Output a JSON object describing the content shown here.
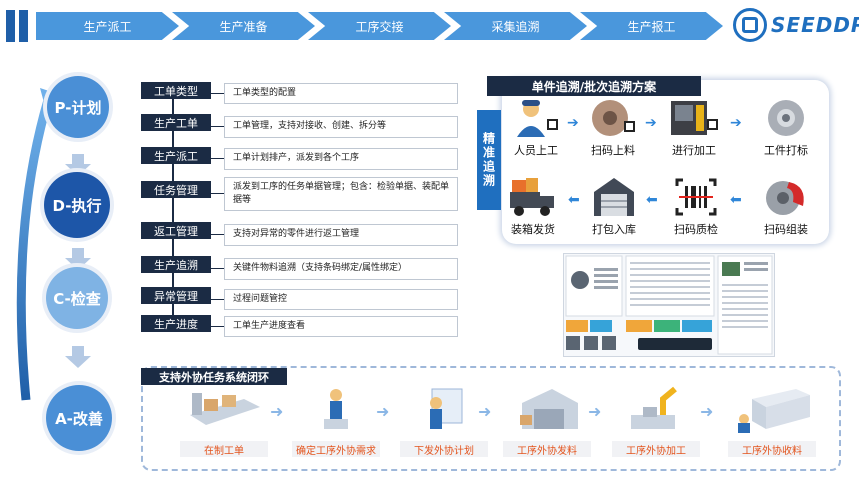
{
  "nav": {
    "steps": [
      "生产派工",
      "生产准备",
      "工序交接",
      "采集追溯",
      "生产报工"
    ]
  },
  "brand": {
    "logo_text": "SEEDDP",
    "color": "#1f6fbf"
  },
  "pdca": [
    {
      "label": "P-计划"
    },
    {
      "label": "D-执行"
    },
    {
      "label": "C-检查"
    },
    {
      "label": "A-改善"
    }
  ],
  "functions": [
    {
      "label": "工单类型",
      "desc": "工单类型的配置"
    },
    {
      "label": "生产工单",
      "desc": "工单管理，支持对接收、创建、拆分等"
    },
    {
      "label": "生产派工",
      "desc": "工单计划排产，派发到各个工序"
    },
    {
      "label": "任务管理",
      "desc": "派发到工序的任务单据管理；包含：检验单据、装配单据等"
    },
    {
      "label": "返工管理",
      "desc": "支持对异常的零件进行返工管理"
    },
    {
      "label": "生产追溯",
      "desc": "关键件物料追溯（支持条码绑定/属性绑定）"
    },
    {
      "label": "异常管理",
      "desc": "过程问题管控"
    },
    {
      "label": "生产进度",
      "desc": "工单生产进度查看"
    }
  ],
  "trace": {
    "title": "单件追溯/批次追溯方案",
    "side_label": "精准追溯",
    "steps": [
      "人员上工",
      "扫码上料",
      "进行加工",
      "工件打标",
      "装箱发货",
      "打包入库",
      "扫码质检",
      "扫码组装"
    ]
  },
  "outsource": {
    "title": "支持外协任务系统闭环",
    "steps": [
      "在制工单",
      "确定工序外协需求",
      "下发外协计划",
      "工序外协发料",
      "工序外协加工",
      "工序外协收料"
    ]
  },
  "colors": {
    "nav": "#4a97dc",
    "dark": "#1b2b44",
    "accent": "#e3541d",
    "blue": "#1f6fbf"
  }
}
